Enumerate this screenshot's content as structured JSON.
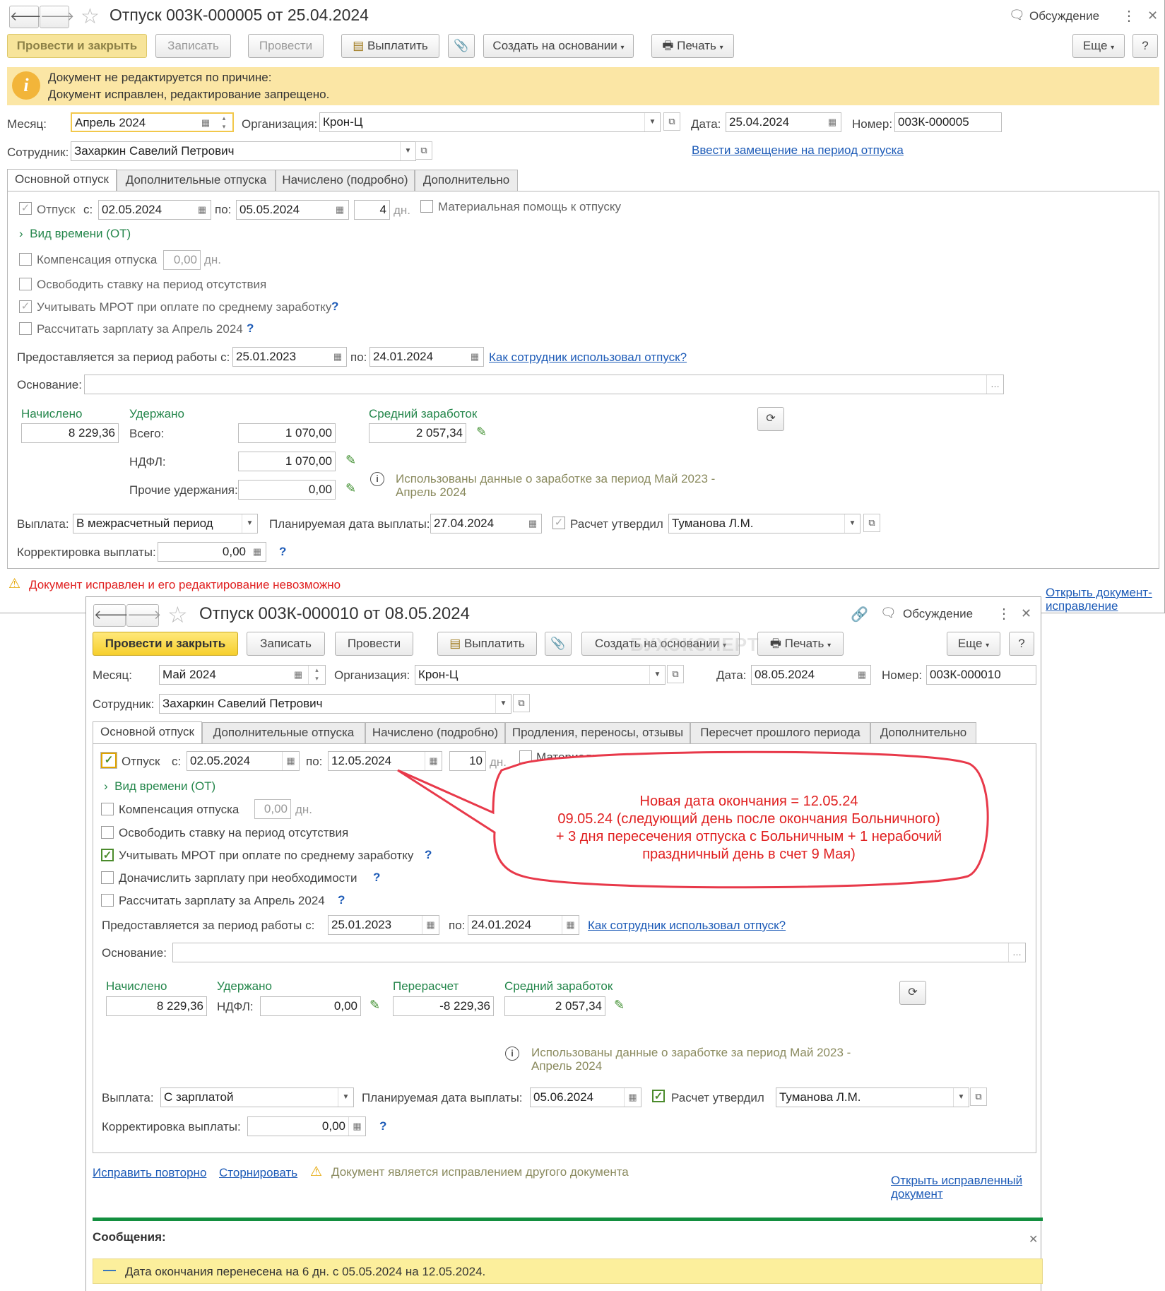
{
  "w1": {
    "title": "Отпуск 003К-000005 от 25.04.2024",
    "discuss": "Обсуждение",
    "toolbar": {
      "post_close": "Провести и закрыть",
      "write": "Записать",
      "post": "Провести",
      "pay": "Выплатить",
      "create_based": "Создать на основании",
      "print": "Печать",
      "more": "Еще",
      "help": "?"
    },
    "banner": {
      "line1": "Документ не редактируется по причине:",
      "line2": "Документ исправлен, редактирование запрещено."
    },
    "month_label": "Месяц:",
    "month": "Апрель 2024",
    "org_label": "Организация:",
    "org": "Крон-Ц",
    "date_label": "Дата:",
    "date": "25.04.2024",
    "number_label": "Номер:",
    "number": "003К-000005",
    "employee_label": "Сотрудник:",
    "employee": "Захаркин Савелий Петрович",
    "substitution_link": "Ввести замещение на период отпуска",
    "tabs": [
      "Основной отпуск",
      "Дополнительные отпуска",
      "Начислено (подробно)",
      "Дополнительно"
    ],
    "vacation_label": "Отпуск",
    "from_label": "с:",
    "from": "02.05.2024",
    "to_label": "по:",
    "to": "05.05.2024",
    "days": "4",
    "days_unit": "дн.",
    "mat_help": "Материальная помощь к отпуску",
    "time_type": "Вид времени (ОТ)",
    "compensation": "Компенсация отпуска",
    "comp_days": "0,00",
    "release_rate": "Освободить ставку на период отсутствия",
    "mrot": "Учитывать МРОТ при оплате по среднему заработку",
    "calc_salary": "Рассчитать зарплату за Апрель 2024",
    "period_label": "Предоставляется за период работы с:",
    "period_from": "25.01.2023",
    "period_to_label": "по:",
    "period_to": "24.01.2024",
    "usage_link": "Как сотрудник использовал отпуск?",
    "basis_label": "Основание:",
    "accrued_label": "Начислено",
    "accrued": "8 229,36",
    "withheld_label": "Удержано",
    "total_label": "Всего:",
    "total": "1 070,00",
    "ndfl_label": "НДФЛ:",
    "ndfl": "1 070,00",
    "other_label": "Прочие удержания:",
    "other": "0,00",
    "avg_label": "Средний заработок",
    "avg": "2 057,34",
    "info_text_1": "Использованы данные о заработке за период Май 2023 -",
    "info_text_2": "Апрель 2024",
    "payout_label": "Выплата:",
    "payout": "В межрасчетный период",
    "planned_label": "Планируемая дата выплаты:",
    "planned": "27.04.2024",
    "approved_label": "Расчет утвердил",
    "approved": "Туманова Л.М.",
    "correction_label": "Корректировка выплаты:",
    "correction": "0,00",
    "warning": "Документ исправлен и его редактирование невозможно",
    "open_fix_link_1": "Открыть документ-",
    "open_fix_link_2": "исправление"
  },
  "w2": {
    "title": "Отпуск 003К-000010 от 08.05.2024",
    "discuss": "Обсуждение",
    "toolbar": {
      "post_close": "Провести и закрыть",
      "write": "Записать",
      "post": "Провести",
      "pay": "Выплатить",
      "create_based": "Создать на основании",
      "print": "Печать",
      "more": "Еще",
      "help": "?"
    },
    "month_label": "Месяц:",
    "month": "Май 2024",
    "org_label": "Организация:",
    "org": "Крон-Ц",
    "date_label": "Дата:",
    "date": "08.05.2024",
    "number_label": "Номер:",
    "number": "003К-000010",
    "employee_label": "Сотрудник:",
    "employee": "Захаркин Савелий Петрович",
    "tabs": [
      "Основной отпуск",
      "Дополнительные отпуска",
      "Начислено (подробно)",
      "Продления, переносы, отзывы",
      "Пересчет прошлого периода",
      "Дополнительно"
    ],
    "vacation_label": "Отпуск",
    "from_label": "с:",
    "from": "02.05.2024",
    "to_label": "по:",
    "to": "12.05.2024",
    "days": "10",
    "days_unit": "дн.",
    "mat_help": "Материальная помощь к отпуску",
    "time_type": "Вид времени (ОТ)",
    "compensation": "Компенсация отпуска",
    "comp_days": "0,00",
    "release_rate": "Освободить ставку на период отсутствия",
    "mrot": "Учитывать МРОТ при оплате по среднему заработку",
    "extra_salary": "Доначислить зарплату при необходимости",
    "calc_salary": "Рассчитать зарплату за Апрель 2024",
    "period_label": "Предоставляется за период работы с:",
    "period_from": "25.01.2023",
    "period_to_label": "по:",
    "period_to": "24.01.2024",
    "usage_link": "Как сотрудник использовал отпуск?",
    "basis_label": "Основание:",
    "accrued_label": "Начислено",
    "accrued": "8 229,36",
    "withheld_label": "Удержано",
    "ndfl_label": "НДФЛ:",
    "ndfl": "0,00",
    "recalc_label": "Перерасчет",
    "recalc": "-8 229,36",
    "avg_label": "Средний заработок",
    "avg": "2 057,34",
    "info_text_1": "Использованы данные о заработке за период Май 2023 -",
    "info_text_2": "Апрель 2024",
    "payout_label": "Выплата:",
    "payout": "С зарплатой",
    "planned_label": "Планируемая дата выплаты:",
    "planned": "05.06.2024",
    "approved_label": "Расчет утвердил",
    "approved": "Туманова Л.М.",
    "correction_label": "Корректировка выплаты:",
    "correction": "0,00",
    "fix_again": "Исправить повторно",
    "storno": "Сторнировать",
    "note": "Документ является исправлением другого документа",
    "open_fixed_1": "Открыть исправленный",
    "open_fixed_2": "документ",
    "messages_title": "Сообщения:",
    "message": "Дата окончания перенесена на 6 дн. с 05.05.2024 на 12.05.2024."
  },
  "callout": {
    "line1": "Новая дата окончания =  12.05.24",
    "line2": "09.05.24 (следующий день после окончания Больничного)",
    "line3": "+ 3 дня пересечения отпуска с Больничным  + 1 нерабочий",
    "line4": "праздничный день в счет 9 Мая)"
  },
  "watermark": "БУХЭКСПЕРТ",
  "colors": {
    "accent_yellow": "#f6cf2d",
    "banner": "#fbe6a5",
    "green": "#24864b",
    "link": "#1d5bb7",
    "callout_red": "#e8394a",
    "messages_bar": "#fcef9c"
  }
}
